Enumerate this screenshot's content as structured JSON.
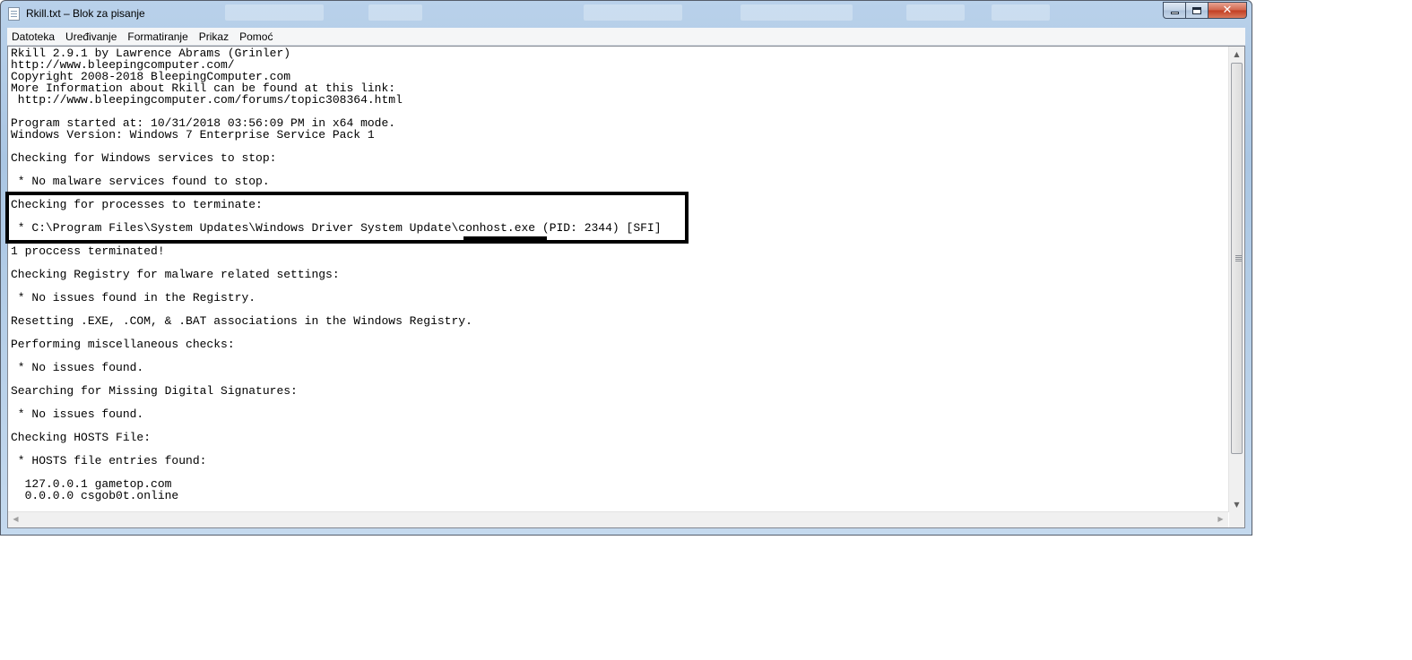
{
  "window": {
    "title": "Rkill.txt – Blok za pisanje",
    "icon": "notepad-icon"
  },
  "caption_buttons": {
    "minimize": "minimize-icon",
    "maximize": "maximize-icon",
    "close": "close-icon"
  },
  "menu": [
    {
      "label": "Datoteka"
    },
    {
      "label": "Uređivanje"
    },
    {
      "label": "Formatiranje"
    },
    {
      "label": "Prikaz"
    },
    {
      "label": "Pomoć"
    }
  ],
  "document": {
    "lines": [
      "Rkill 2.9.1 by Lawrence Abrams (Grinler)",
      "http://www.bleepingcomputer.com/",
      "Copyright 2008-2018 BleepingComputer.com",
      "More Information about Rkill can be found at this link:",
      " http://www.bleepingcomputer.com/forums/topic308364.html",
      "",
      "Program started at: 10/31/2018 03:56:09 PM in x64 mode.",
      "Windows Version: Windows 7 Enterprise Service Pack 1",
      "",
      "Checking for Windows services to stop:",
      "",
      " * No malware services found to stop.",
      "",
      "Checking for processes to terminate:",
      "",
      " * C:\\Program Files\\System Updates\\Windows Driver System Update\\conhost.exe (PID: 2344) [SFI]",
      "",
      "1 proccess terminated!",
      "",
      "Checking Registry for malware related settings:",
      "",
      " * No issues found in the Registry.",
      "",
      "Resetting .EXE, .COM, & .BAT associations in the Windows Registry.",
      "",
      "Performing miscellaneous checks:",
      "",
      " * No issues found.",
      "",
      "Searching for Missing Digital Signatures:",
      "",
      " * No issues found.",
      "",
      "Checking HOSTS File:",
      "",
      " * HOSTS file entries found:",
      "",
      "  127.0.0.1 gametop.com",
      "  0.0.0.0 csgob0t.online"
    ]
  },
  "scrollbars": {
    "up": "scroll-up-arrow-icon",
    "down": "scroll-down-arrow-icon",
    "left": "scroll-left-arrow-icon",
    "right": "scroll-right-arrow-icon"
  },
  "colors": {
    "highlight_box": "#000000",
    "window_frame": "#b9d1ea",
    "close_button": "#c23d21"
  }
}
